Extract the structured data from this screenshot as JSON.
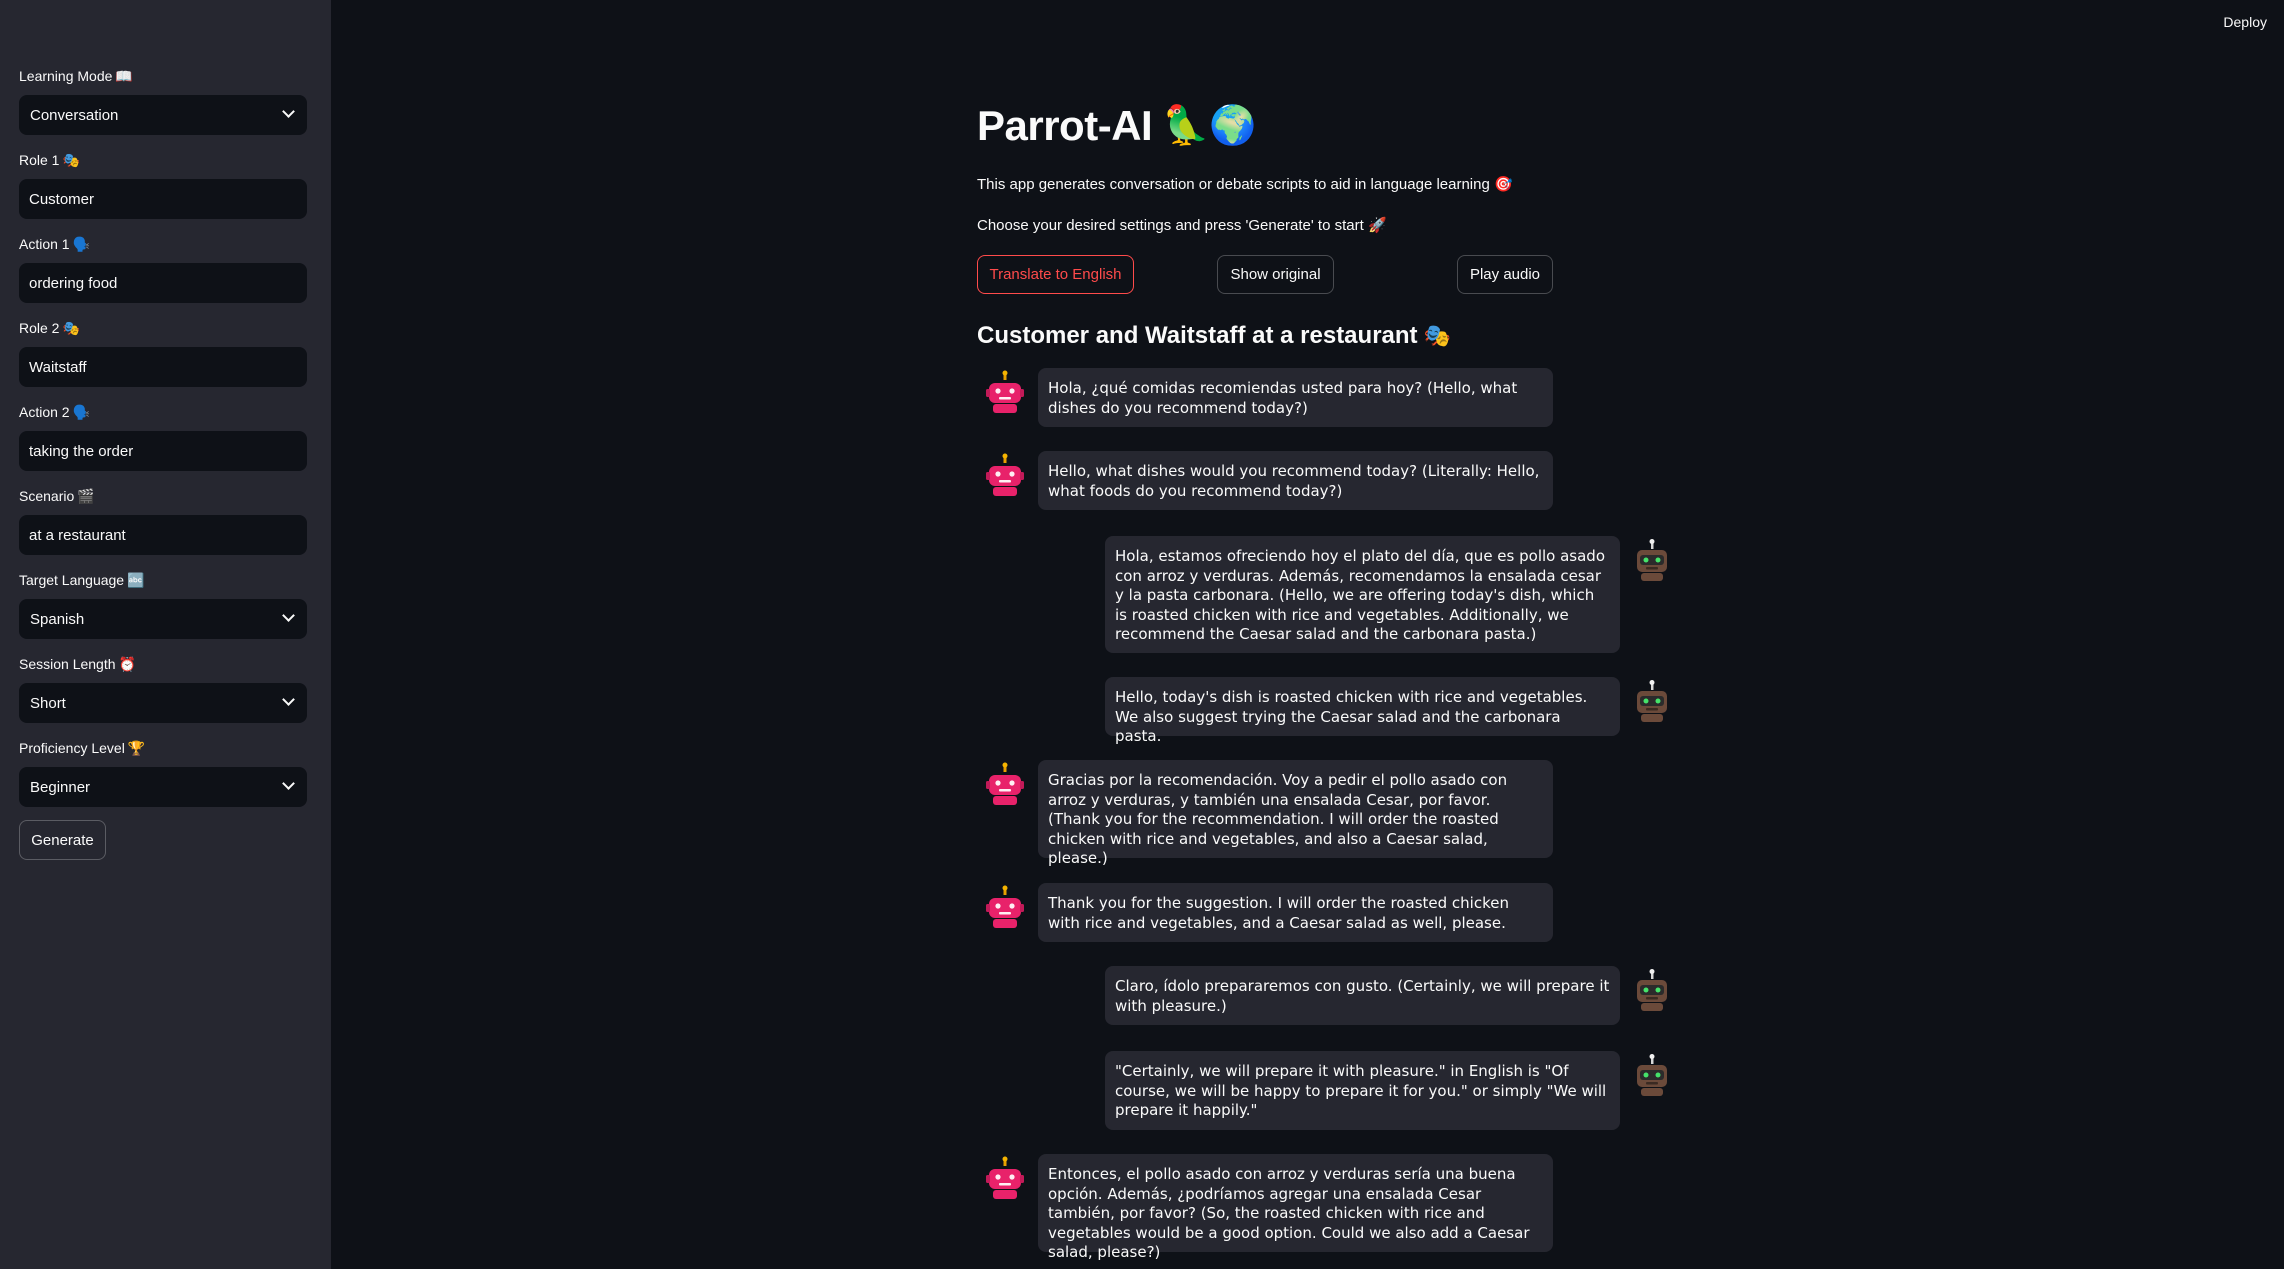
{
  "header": {
    "deploy_label": "Deploy"
  },
  "sidebar": {
    "learning_mode": {
      "label": "Learning Mode",
      "emoji": "📖",
      "value": "Conversation"
    },
    "role1": {
      "label": "Role 1",
      "emoji": "🎭",
      "value": "Customer"
    },
    "action1": {
      "label": "Action 1",
      "emoji": "🗣️",
      "value": "ordering food"
    },
    "role2": {
      "label": "Role 2",
      "emoji": "🎭",
      "value": "Waitstaff"
    },
    "action2": {
      "label": "Action 2",
      "emoji": "🗣️",
      "value": "taking the order"
    },
    "scenario": {
      "label": "Scenario",
      "emoji": "🎬",
      "value": "at a restaurant"
    },
    "target_language": {
      "label": "Target Language",
      "emoji": "🔤",
      "value": "Spanish"
    },
    "session_length": {
      "label": "Session Length",
      "emoji": "⏰",
      "value": "Short"
    },
    "proficiency": {
      "label": "Proficiency Level",
      "emoji": "🏆",
      "value": "Beginner"
    },
    "generate_label": "Generate"
  },
  "main": {
    "title": "Parrot-AI",
    "title_emoji": "🦜🌍",
    "intro": "This app generates conversation or debate scripts to aid in language learning 🎯",
    "instructions": "Choose your desired settings and press 'Generate' to start 🚀",
    "buttons": {
      "translate": "Translate to English",
      "show_original": "Show original",
      "play_audio": "Play audio"
    },
    "subheader": "Customer and Waitstaff at a restaurant",
    "subheader_emoji": "🎭",
    "messages": [
      {
        "speaker": "customer",
        "text": "Hola, ¿qué comidas recomiendas usted para hoy? (Hello, what dishes do you recommend today?)"
      },
      {
        "speaker": "customer",
        "text": "Hello, what dishes would you recommend today? (Literally: Hello, what foods do you recommend today?)"
      },
      {
        "speaker": "waitstaff",
        "text": "Hola, estamos ofreciendo hoy el plato del día, que es pollo asado con arroz y verduras. Además, recomendamos la ensalada cesar y la pasta carbonara. (Hello, we are offering today's dish, which is roasted chicken with rice and vegetables. Additionally, we recommend the Caesar salad and the carbonara pasta.)"
      },
      {
        "speaker": "waitstaff",
        "text": "Hello, today's dish is roasted chicken with rice and vegetables. We also suggest trying the Caesar salad and the carbonara pasta."
      },
      {
        "speaker": "customer",
        "text": "Gracias por la recomendación. Voy a pedir el pollo asado con arroz y verduras, y también una ensalada Cesar, por favor. (Thank you for the recommendation. I will order the roasted chicken with rice and vegetables, and also a Caesar salad, please.)"
      },
      {
        "speaker": "customer",
        "text": "Thank you for the suggestion. I will order the roasted chicken with rice and vegetables, and a Caesar salad as well, please."
      },
      {
        "speaker": "waitstaff",
        "text": "Claro, ídolo prepararemos con gusto. (Certainly, we will prepare it with pleasure.)"
      },
      {
        "speaker": "waitstaff",
        "text": "\"Certainly, we will prepare it with pleasure.\" in English is \"Of course, we will be happy to prepare it for you.\" or simply \"We will prepare it happily.\""
      },
      {
        "speaker": "customer",
        "text": "Entonces, el pollo asado con arroz y verduras sería una buena opción. Además, ¿podríamos agregar una ensalada Cesar también, por favor? (So, the roasted chicken with rice and vegetables would be a good option. Could we also add a Caesar salad, please?)"
      }
    ]
  },
  "colors": {
    "background": "#0e1117",
    "sidebar": "#262730",
    "accent": "#ff4b4b",
    "user_avatar": "#e8226a",
    "assistant_avatar": "#4a4a4f"
  },
  "icons": {
    "user_avatar": "pink-robot-icon",
    "assistant_avatar": "brown-robot-icon",
    "select": "chevron-down-icon"
  }
}
